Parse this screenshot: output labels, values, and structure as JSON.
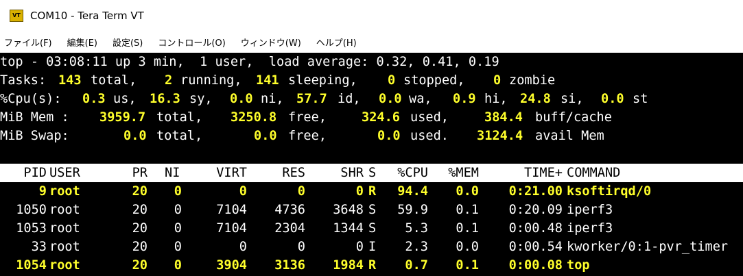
{
  "window": {
    "icon_text": "VT",
    "title": "COM10 - Tera Term VT"
  },
  "menu": [
    {
      "label": "ファイル(F)"
    },
    {
      "label": "編集(E)"
    },
    {
      "label": "設定(S)"
    },
    {
      "label": "コントロール(O)"
    },
    {
      "label": "ウィンドウ(W)"
    },
    {
      "label": "ヘルプ(H)"
    }
  ],
  "summary": {
    "line1": "top - 03:08:11 up 3 min,  1 user,  load average: 0.32, 0.41, 0.19",
    "tasks": {
      "label": "Tasks:",
      "total": "143",
      "total_label": "total,",
      "running": "2",
      "running_label": "running,",
      "sleeping": "141",
      "sleeping_label": "sleeping,",
      "stopped": "0",
      "stopped_label": "stopped,",
      "zombie": "0",
      "zombie_label": "zombie"
    },
    "cpu": {
      "label": "%Cpu(s):",
      "us": "0.3",
      "us_label": "us,",
      "sy": "16.3",
      "sy_label": "sy,",
      "ni": "0.0",
      "ni_label": "ni,",
      "id": "57.7",
      "id_label": "id,",
      "wa": "0.0",
      "wa_label": "wa,",
      "hi": "0.9",
      "hi_label": "hi,",
      "si": "24.8",
      "si_label": "si,",
      "st": "0.0",
      "st_label": "st"
    },
    "mem": {
      "label": "MiB Mem :",
      "total": "3959.7",
      "total_label": "total,",
      "free": "3250.8",
      "free_label": "free,",
      "used": "324.6",
      "used_label": "used,",
      "cache": "384.4",
      "cache_label": "buff/cache"
    },
    "swap": {
      "label": "MiB Swap:",
      "total": "0.0",
      "total_label": "total,",
      "free": "0.0",
      "free_label": "free,",
      "used": "0.0",
      "used_label": "used.",
      "avail": "3124.4",
      "avail_label": "avail Mem"
    }
  },
  "process_table": {
    "columns": [
      "PID",
      "USER",
      "PR",
      "NI",
      "VIRT",
      "RES",
      "SHR",
      "S",
      "%CPU",
      "%MEM",
      "TIME+",
      "COMMAND"
    ],
    "rows": [
      {
        "pid": "9",
        "user": "root",
        "pr": "20",
        "ni": "0",
        "virt": "0",
        "res": "0",
        "shr": "0",
        "s": "R",
        "cpu": "94.4",
        "mem": "0.0",
        "time": "0:21.00",
        "command": "ksoftirqd/0",
        "highlight": "yellow"
      },
      {
        "pid": "1050",
        "user": "root",
        "pr": "20",
        "ni": "0",
        "virt": "7104",
        "res": "4736",
        "shr": "3648",
        "s": "S",
        "cpu": "59.9",
        "mem": "0.1",
        "time": "0:20.09",
        "command": "iperf3",
        "highlight": "white"
      },
      {
        "pid": "1053",
        "user": "root",
        "pr": "20",
        "ni": "0",
        "virt": "7104",
        "res": "2304",
        "shr": "1344",
        "s": "S",
        "cpu": "5.3",
        "mem": "0.1",
        "time": "0:00.48",
        "command": "iperf3",
        "highlight": "white"
      },
      {
        "pid": "33",
        "user": "root",
        "pr": "20",
        "ni": "0",
        "virt": "0",
        "res": "0",
        "shr": "0",
        "s": "I",
        "cpu": "2.3",
        "mem": "0.0",
        "time": "0:00.54",
        "command": "kworker/0:1-pvr_timer",
        "highlight": "white"
      },
      {
        "pid": "1054",
        "user": "root",
        "pr": "20",
        "ni": "0",
        "virt": "3904",
        "res": "3136",
        "shr": "1984",
        "s": "R",
        "cpu": "0.7",
        "mem": "0.1",
        "time": "0:00.08",
        "command": "top",
        "highlight": "yellow"
      }
    ]
  },
  "colors": {
    "terminal_bg": "#000000",
    "terminal_fg": "#ffffff",
    "highlight": "#ffff2b",
    "header_bg": "#ffffff"
  }
}
